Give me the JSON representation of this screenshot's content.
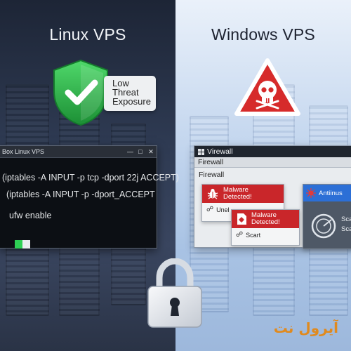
{
  "left": {
    "title": "Linux VPS",
    "badge": {
      "line1": "Low",
      "line2": "Threat",
      "line3": "Exposure"
    },
    "shield_color": "#2fb24a",
    "terminal": {
      "title": "Box Linux VPS",
      "lines": [
        "(iptables -A INPUT -p tcp -dport 22j ACCEPT)",
        "(iptables -A INPUT -p -dport_ACCEPT",
        "ufw enable"
      ]
    }
  },
  "right": {
    "title": "Windows VPS",
    "warning_color": "#d62b2b",
    "firewall_window": {
      "title": "Virewall",
      "tab": "Firewall",
      "section": "Firewall",
      "alerts": [
        {
          "line1": "Malware",
          "line2": "Detected!",
          "footer": "Unel"
        },
        {
          "line1": "Malware",
          "line2": "Detected!",
          "footer": "Scart"
        }
      ],
      "antivirus": {
        "title": "Antiinus",
        "scan1": "Scar",
        "scan2": "Sca"
      }
    }
  },
  "brand": {
    "color": "#e08a1e",
    "text": "آیرول نت"
  }
}
